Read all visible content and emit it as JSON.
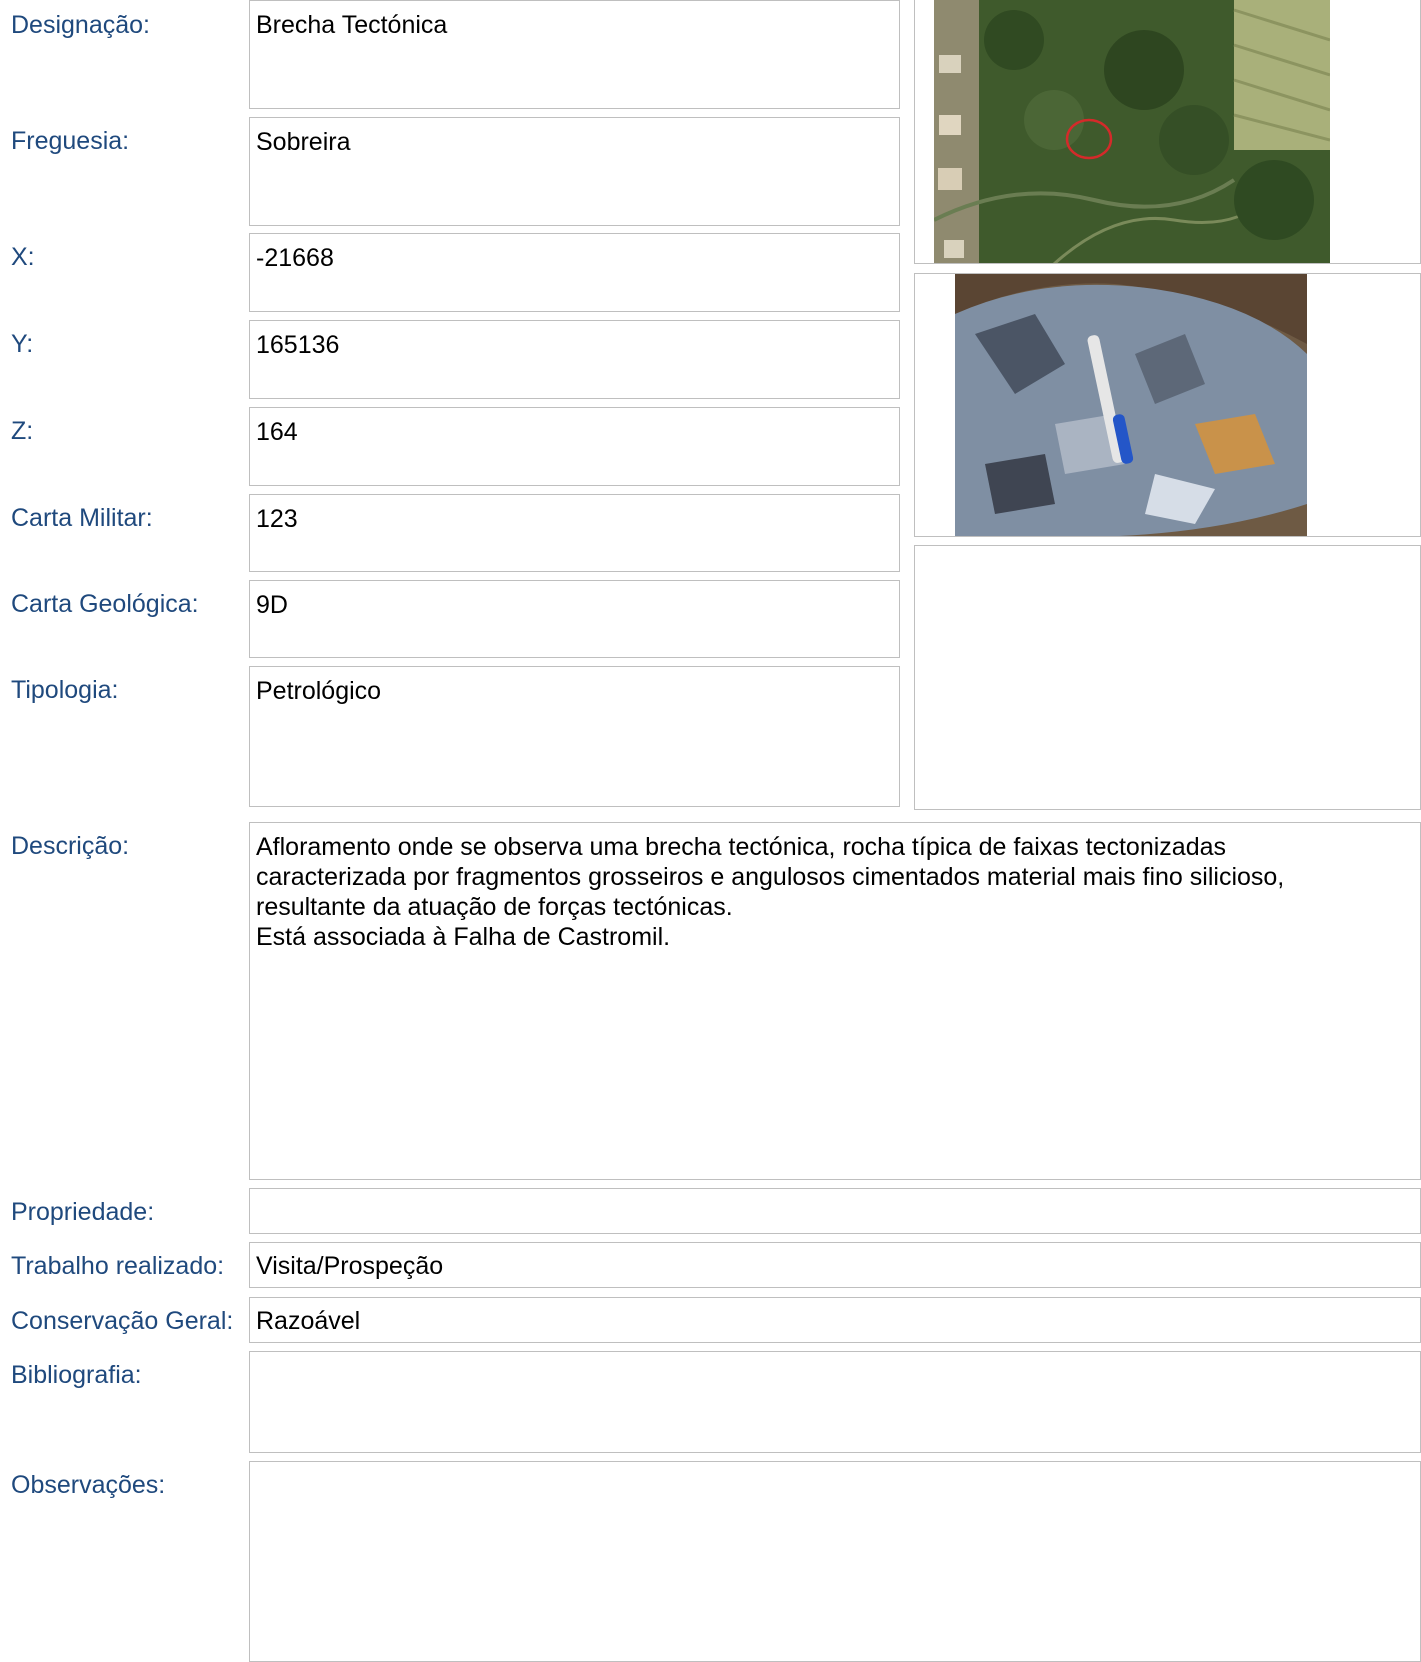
{
  "fields": {
    "designacao": {
      "label": "Designação:",
      "value": "Brecha Tectónica"
    },
    "freguesia": {
      "label": "Freguesia:",
      "value": "Sobreira"
    },
    "x": {
      "label": "X:",
      "value": "-21668"
    },
    "y": {
      "label": "Y:",
      "value": "165136"
    },
    "z": {
      "label": "Z:",
      "value": "164"
    },
    "carta_militar": {
      "label": "Carta Militar:",
      "value": "123"
    },
    "carta_geologica": {
      "label": "Carta Geológica:",
      "value": "9D"
    },
    "tipologia": {
      "label": "Tipologia:",
      "value": "Petrológico"
    },
    "descricao": {
      "label": "Descrição:",
      "value": "Afloramento onde se observa uma brecha tectónica, rocha típica de faixas tectonizadas\ncaracterizada por fragmentos grosseiros e angulosos cimentados material mais fino silicioso,\nresultante da atuação de forças tectónicas.\nEstá associada à Falha de Castromil."
    },
    "propriedade": {
      "label": "Propriedade:",
      "value": ""
    },
    "trabalho": {
      "label": "Trabalho realizado:",
      "value": "Visita/Prospeção"
    },
    "conservacao": {
      "label": "Conservação Geral:",
      "value": "Razoável"
    },
    "bibliografia": {
      "label": "Bibliografia:",
      "value": ""
    },
    "observacoes": {
      "label": "Observações:",
      "value": ""
    }
  },
  "colors": {
    "label": "#1f497d",
    "border": "#bfbfbf",
    "map_highlight": "#d42a2a"
  }
}
